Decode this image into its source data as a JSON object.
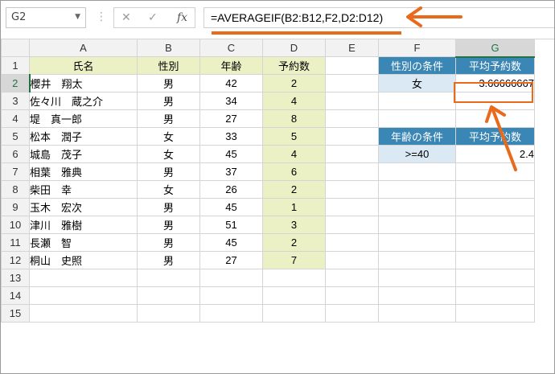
{
  "formula_bar": {
    "name_box": "G2",
    "cancel_icon": "✕",
    "enter_icon": "✓",
    "fx_icon": "fx",
    "formula": "=AVERAGEIF(B2:B12,F2,D2:D12)"
  },
  "columns": [
    "A",
    "B",
    "C",
    "D",
    "E",
    "F",
    "G"
  ],
  "rows": [
    "1",
    "2",
    "3",
    "4",
    "5",
    "6",
    "7",
    "8",
    "9",
    "10",
    "11",
    "12",
    "13",
    "14",
    "15"
  ],
  "table": {
    "headers": [
      "氏名",
      "性別",
      "年齢",
      "予約数"
    ],
    "records": [
      [
        "櫻井　翔太",
        "男",
        "42",
        "2"
      ],
      [
        "佐々川　蔵之介",
        "男",
        "34",
        "4"
      ],
      [
        "堤　真一郎",
        "男",
        "27",
        "8"
      ],
      [
        "松本　潤子",
        "女",
        "33",
        "5"
      ],
      [
        "城島　茂子",
        "女",
        "45",
        "4"
      ],
      [
        "相葉　雅典",
        "男",
        "37",
        "6"
      ],
      [
        "柴田　幸",
        "女",
        "26",
        "2"
      ],
      [
        "玉木　宏次",
        "男",
        "45",
        "1"
      ],
      [
        "津川　雅樹",
        "男",
        "51",
        "3"
      ],
      [
        "長瀬　智",
        "男",
        "45",
        "2"
      ],
      [
        "桐山　史照",
        "男",
        "27",
        "7"
      ]
    ]
  },
  "criteria1": {
    "header_condition": "性別の条件",
    "header_avg": "平均予約数",
    "condition": "女",
    "result": "3.66666667"
  },
  "criteria2": {
    "header_condition": "年齢の条件",
    "header_avg": "平均予約数",
    "condition": ">=40",
    "result": "2.4"
  },
  "colors": {
    "accent_orange": "#ea6a1c",
    "header_blue": "#3a86b5",
    "light_blue": "#dbe9f4",
    "table_green": "#ebf0c5",
    "excel_green": "#217346"
  }
}
